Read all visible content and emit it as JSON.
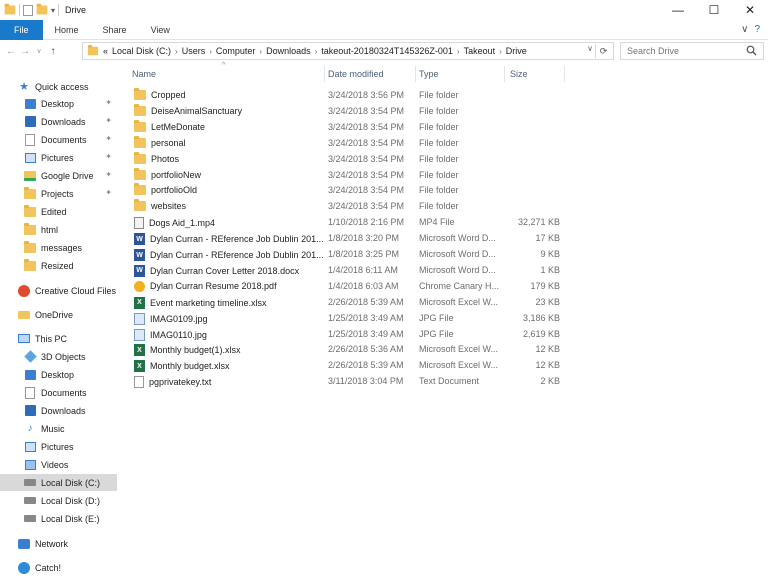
{
  "window": {
    "title": "Drive",
    "controls": {
      "minimize": "—",
      "maximize": "☐",
      "close": "✕"
    }
  },
  "ribbon": {
    "tabs": [
      "File",
      "Home",
      "Share",
      "View"
    ],
    "expand": "∨",
    "help": "?"
  },
  "address": {
    "prefix": "«",
    "crumbs": [
      "Local Disk (C:)",
      "Computer",
      "Users",
      "Computer",
      "Downloads",
      "takeout-20180324T145326Z-001",
      "Takeout",
      "Drive"
    ],
    "dropdown": "∨",
    "refresh": "⟳"
  },
  "search": {
    "placeholder": "Search Drive"
  },
  "nav": {
    "quick_access": "Quick access",
    "pinned": [
      {
        "label": "Desktop",
        "icon": "desktop-icon"
      },
      {
        "label": "Downloads",
        "icon": "downloads-icon"
      },
      {
        "label": "Documents",
        "icon": "documents-icon"
      },
      {
        "label": "Pictures",
        "icon": "pictures-icon"
      },
      {
        "label": "Google Drive",
        "icon": "google-drive-icon"
      },
      {
        "label": "Projects",
        "icon": "folder-icon"
      }
    ],
    "recent": [
      "Edited",
      "html",
      "messages",
      "Resized"
    ],
    "creative_cloud": "Creative Cloud Files",
    "onedrive": "OneDrive",
    "this_pc": "This PC",
    "pc_items": [
      "3D Objects",
      "Desktop",
      "Documents",
      "Downloads",
      "Music",
      "Pictures",
      "Videos"
    ],
    "disks": [
      "Local Disk (C:)",
      "Local Disk (D:)",
      "Local Disk (E:)"
    ],
    "network": "Network",
    "catch": "Catch!",
    "pin_glyph": "📌"
  },
  "columns": {
    "name": "Name",
    "date": "Date modified",
    "type": "Type",
    "size": "Size",
    "sort_glyph": "^"
  },
  "files": [
    {
      "name": "Cropped",
      "date": "3/24/2018 3:56 PM",
      "type": "File folder",
      "size": "",
      "icon": "folder"
    },
    {
      "name": "DeiseAnimalSanctuary",
      "date": "3/24/2018 3:54 PM",
      "type": "File folder",
      "size": "",
      "icon": "folder"
    },
    {
      "name": "LetMeDonate",
      "date": "3/24/2018 3:54 PM",
      "type": "File folder",
      "size": "",
      "icon": "folder"
    },
    {
      "name": "personal",
      "date": "3/24/2018 3:54 PM",
      "type": "File folder",
      "size": "",
      "icon": "folder"
    },
    {
      "name": "Photos",
      "date": "3/24/2018 3:54 PM",
      "type": "File folder",
      "size": "",
      "icon": "folder"
    },
    {
      "name": "portfolioNew",
      "date": "3/24/2018 3:54 PM",
      "type": "File folder",
      "size": "",
      "icon": "folder"
    },
    {
      "name": "portfolioOld",
      "date": "3/24/2018 3:54 PM",
      "type": "File folder",
      "size": "",
      "icon": "folder"
    },
    {
      "name": "websites",
      "date": "3/24/2018 3:54 PM",
      "type": "File folder",
      "size": "",
      "icon": "folder"
    },
    {
      "name": "Dogs Aid_1.mp4",
      "date": "1/10/2018 2:16 PM",
      "type": "MP4 File",
      "size": "32,271 KB",
      "icon": "mp4"
    },
    {
      "name": "Dylan Curran - REference Job Dublin 201...",
      "date": "1/8/2018 3:20 PM",
      "type": "Microsoft Word D...",
      "size": "17 KB",
      "icon": "word"
    },
    {
      "name": "Dylan Curran - REference Job Dublin 201...",
      "date": "1/8/2018 3:25 PM",
      "type": "Microsoft Word D...",
      "size": "9 KB",
      "icon": "word"
    },
    {
      "name": "Dylan Curran Cover Letter 2018.docx",
      "date": "1/4/2018 6:11 AM",
      "type": "Microsoft Word D...",
      "size": "1 KB",
      "icon": "word"
    },
    {
      "name": "Dylan Curran Resume 2018.pdf",
      "date": "1/4/2018 6:03 AM",
      "type": "Chrome Canary H...",
      "size": "179 KB",
      "icon": "pdf"
    },
    {
      "name": "Event marketing timeline.xlsx",
      "date": "2/26/2018 5:39 AM",
      "type": "Microsoft Excel W...",
      "size": "23 KB",
      "icon": "excel"
    },
    {
      "name": "IMAG0109.jpg",
      "date": "1/25/2018 3:49 AM",
      "type": "JPG File",
      "size": "3,186 KB",
      "icon": "jpg"
    },
    {
      "name": "IMAG0110.jpg",
      "date": "1/25/2018 3:49 AM",
      "type": "JPG File",
      "size": "2,619 KB",
      "icon": "jpg"
    },
    {
      "name": "Monthly budget(1).xlsx",
      "date": "2/26/2018 5:36 AM",
      "type": "Microsoft Excel W...",
      "size": "12 KB",
      "icon": "excel"
    },
    {
      "name": "Monthly budget.xlsx",
      "date": "2/26/2018 5:39 AM",
      "type": "Microsoft Excel W...",
      "size": "12 KB",
      "icon": "excel"
    },
    {
      "name": "pgprivatekey.txt",
      "date": "3/11/2018 3:04 PM",
      "type": "Text Document",
      "size": "2 KB",
      "icon": "doc"
    }
  ],
  "colors": {
    "file_tab": "#1979ca",
    "folder": "#f2c55c",
    "selection": "#d9d9d9"
  }
}
